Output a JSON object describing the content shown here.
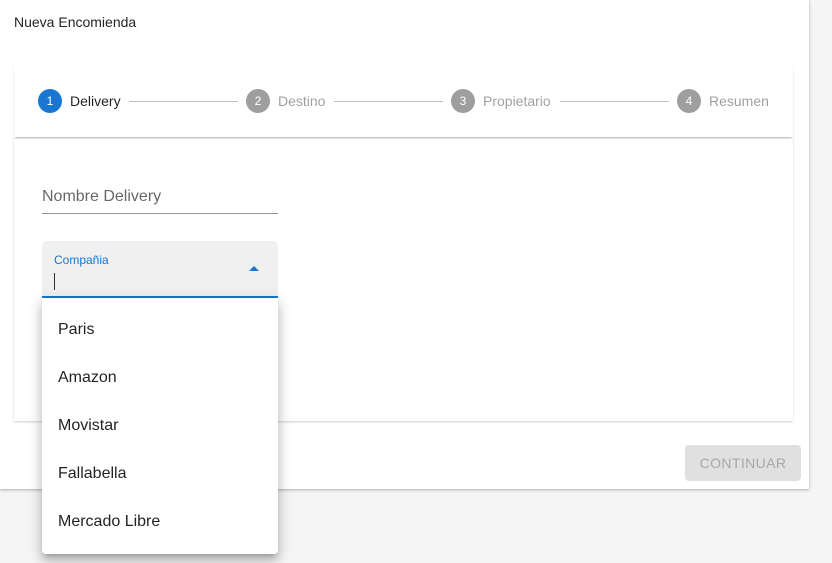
{
  "page": {
    "title": "Nueva Encomienda"
  },
  "stepper": {
    "steps": [
      {
        "number": "1",
        "label": "Delivery",
        "active": true
      },
      {
        "number": "2",
        "label": "Destino",
        "active": false
      },
      {
        "number": "3",
        "label": "Propietario",
        "active": false
      },
      {
        "number": "4",
        "label": "Resumen",
        "active": false
      }
    ]
  },
  "form": {
    "name_field": {
      "label": "Nombre Delivery",
      "value": ""
    },
    "company_field": {
      "label": "Compañia",
      "value": "",
      "options": [
        "Paris",
        "Amazon",
        "Movistar",
        "Fallabella",
        "Mercado Libre"
      ]
    }
  },
  "actions": {
    "continue_label": "CONTINUAR"
  },
  "colors": {
    "primary": "#1976d2",
    "inactive_step": "#9e9e9e"
  }
}
